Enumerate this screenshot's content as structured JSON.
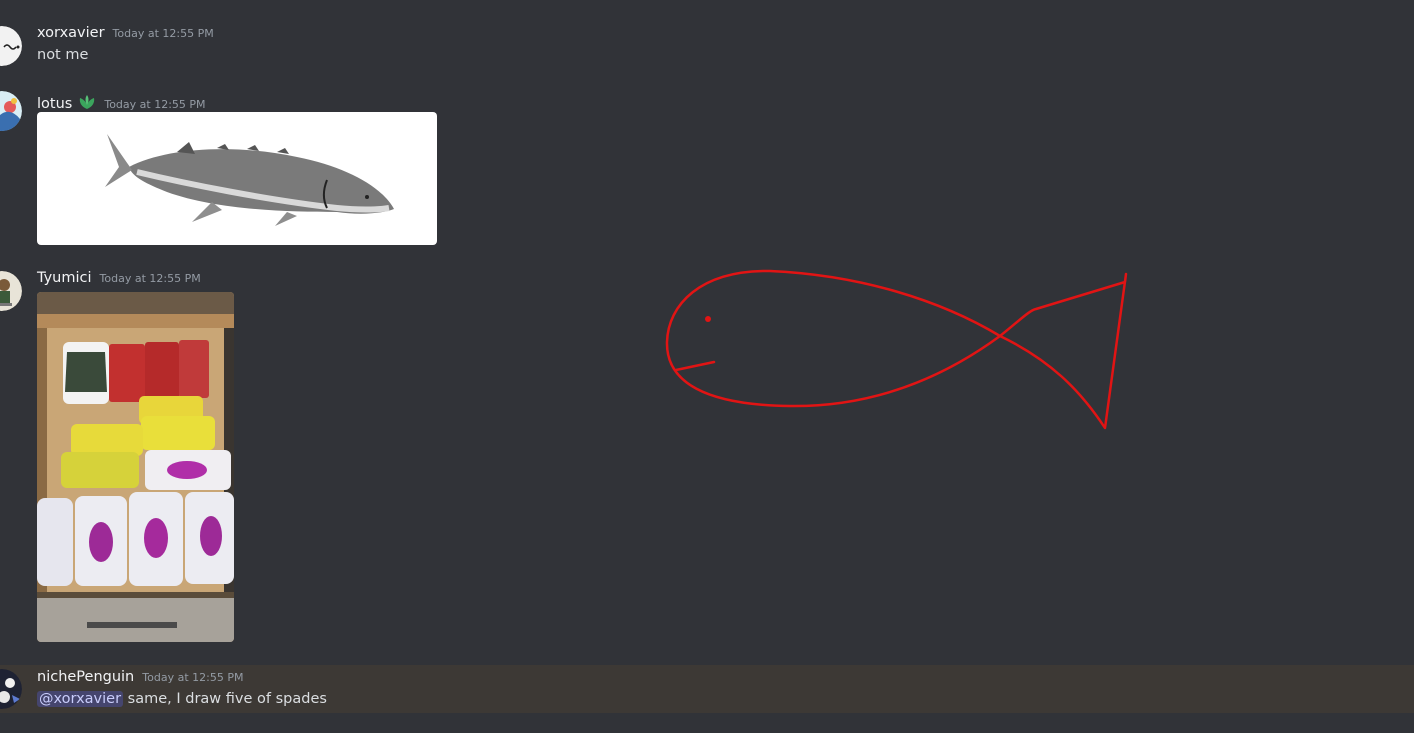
{
  "messages": [
    {
      "username": "xorxavier",
      "timestamp": "Today at 12:55 PM",
      "text": "not me"
    },
    {
      "username": "lotus",
      "timestamp": "Today at 12:55 PM",
      "badge": "lotus-leaf-icon",
      "attachment": "sturgeon fish photo"
    },
    {
      "username": "Tyumici",
      "timestamp": "Today at 12:55 PM",
      "attachment": "drawer of sardine tins photo"
    },
    {
      "username": "nichePenguin",
      "timestamp": "Today at 12:55 PM",
      "mention": "@xorxavier",
      "text": " same, I draw five of spades"
    }
  ],
  "colors": {
    "background": "#313338",
    "highlight": "#3d3935",
    "drawing_stroke": "#e11414",
    "mention_bg": "#4c5080",
    "mention_text": "#c9cdfb"
  }
}
